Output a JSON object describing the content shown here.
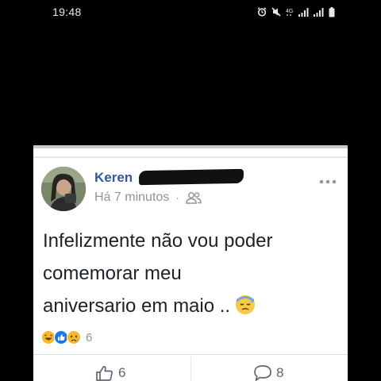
{
  "status_bar": {
    "time": "19:48",
    "icons": [
      "alarm-icon",
      "mute-icon",
      "data-4g-icon",
      "signal-icon",
      "signal-icon",
      "battery-icon"
    ]
  },
  "post": {
    "author_name": "Keren",
    "time_ago": "Há 7 minutos",
    "meta_separator": "·",
    "audience_icon": "friends-icon",
    "text_lines": [
      "Infelizmente não vou poder",
      "comemorar meu",
      "aniversario em maio .."
    ],
    "text_emoji": "sad-sweat-face-emoji",
    "reactions": {
      "icons": [
        "haha-reaction-icon",
        "like-reaction-icon",
        "sad-reaction-icon"
      ],
      "count": "6"
    },
    "actions": {
      "like_count": "6",
      "comment_count": "8"
    }
  },
  "colors": {
    "background": "#000000",
    "card": "#ffffff",
    "author_name": "#365899",
    "meta": "#90949c",
    "text": "#1d2129",
    "like_blue": "#1877f2",
    "reaction_yellow": "#f7b928"
  }
}
